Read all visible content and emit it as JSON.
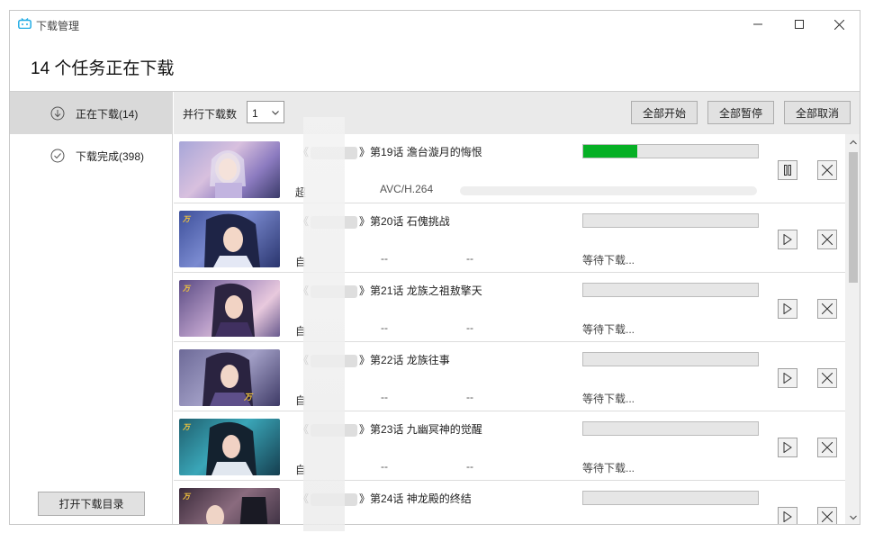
{
  "window": {
    "title": "下载管理",
    "controls": {
      "minimize": "minimize-icon",
      "maximize": "maximize-icon",
      "close": "close-icon"
    }
  },
  "page_heading": "14 个任务正在下载",
  "sidebar": {
    "items": [
      {
        "label": "正在下载(14)",
        "icon": "download-icon",
        "active": true
      },
      {
        "label": "下载完成(398)",
        "icon": "check-circle-icon",
        "active": false
      }
    ],
    "open_dir_label": "打开下载目录"
  },
  "toolbar": {
    "parallel_label": "并行下载数",
    "parallel_value": "1",
    "start_all": "全部开始",
    "pause_all": "全部暂停",
    "cancel_all": "全部取消"
  },
  "tasks": [
    {
      "title_open": "《",
      "title_close": "》第19话 澹台漩月的悔恨",
      "sub": "超",
      "codec": "AVC/H.264",
      "progress": 0.31,
      "status": "",
      "action": "pause"
    },
    {
      "title_open": "《",
      "title_close": "》第20话 石傀挑战",
      "sub": "自",
      "col1": "--",
      "col2": "--",
      "progress": 0,
      "status": "等待下载...",
      "action": "play"
    },
    {
      "title_open": "《",
      "title_close": "》第21话 龙族之祖敖擎天",
      "sub": "自",
      "col1": "--",
      "col2": "--",
      "progress": 0,
      "status": "等待下载...",
      "action": "play"
    },
    {
      "title_open": "《",
      "title_close": "》第22话 龙族往事",
      "sub": "自",
      "col1": "--",
      "col2": "--",
      "progress": 0,
      "status": "等待下载...",
      "action": "play"
    },
    {
      "title_open": "《",
      "title_close": "》第23话 九幽冥神的觉醒",
      "sub": "自",
      "col1": "--",
      "col2": "--",
      "progress": 0,
      "status": "等待下载...",
      "action": "play"
    },
    {
      "title_open": "《",
      "title_close": "》第24话 神龙殿的终结",
      "sub": "",
      "col1": "",
      "col2": "",
      "progress": 0,
      "status": "",
      "action": "play"
    }
  ],
  "colors": {
    "progress_fill": "#06b025",
    "active_sidebar": "#d9d9d9",
    "toolbar_bg": "#eaeaea"
  }
}
